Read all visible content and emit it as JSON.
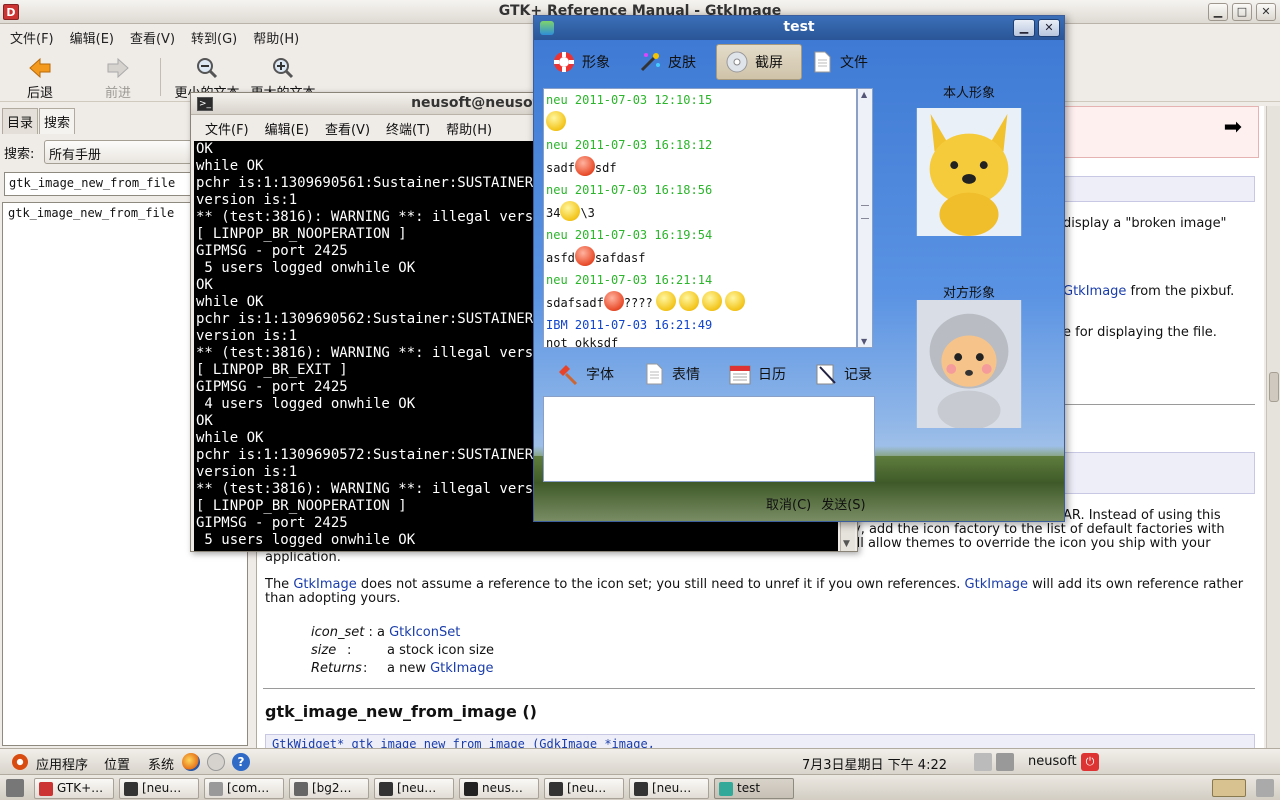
{
  "devhelp": {
    "title": "GTK+ Reference Manual - GtkImage",
    "menu": [
      "文件(F)",
      "编辑(E)",
      "查看(V)",
      "转到(G)",
      "帮助(H)"
    ],
    "toolbar": {
      "back": "后退",
      "forward": "前进",
      "smaller_text": "更小的文本",
      "larger_text": "更大的文本"
    },
    "tabs": [
      "目录",
      "搜索"
    ],
    "search_label": "搜索:",
    "search_scope": "所有手册",
    "search_query": "gtk_image_new_from_file",
    "results": [
      "gtk_image_new_from_file"
    ],
    "doc": {
      "line_broken": "display a \"broken image\"",
      "line_pixbuf_link": "GtkImage",
      "line_pixbuf": " from the pixbuf.",
      "line_display": "e for displaying the file.",
      "line_ar": "AR. Instead of using this",
      "line_factory": "y, add the icon factory to the list of default factories with",
      "line_themes": "ill allow themes to override the icon you ship with your",
      "line_application": "application.",
      "para_the": "The ",
      "para_link1": "GtkImage",
      "para_mid": " does not assume a reference to the icon set; you still need to unref it if you own references. ",
      "para_link2": "GtkImage",
      "para_end": " will add its own reference rather",
      "para_line2": "than adopting yours.",
      "params": [
        {
          "name": "icon_set",
          "sep": " : a ",
          "value": "GtkIconSet",
          "link": true
        },
        {
          "name": "size",
          "sep": " :",
          "value": "a stock icon size",
          "link": false
        },
        {
          "name": "Returns",
          "sep": " :",
          "value_prefix": "a new ",
          "value": "GtkImage",
          "link": true
        }
      ],
      "heading": "gtk_image_new_from_image ()",
      "code": "GtkWidget*          gtk_image_new_from_image            (GdkImage *image,"
    }
  },
  "terminal": {
    "title": "neusoft@neusoft-desktop: ~",
    "menu": [
      "文件(F)",
      "编辑(E)",
      "查看(V)",
      "终端(T)",
      "帮助(H)"
    ],
    "lines": [
      "OK",
      "while OK",
      "pchr is:1:1309690561:Sustainer:SUSTAINER-T",
      "version is:1",
      "** (test:3816): WARNING **: illegal versio",
      "[ LINPOP_BR_NOOPERATION ]",
      "GIPMSG - port 2425",
      " 5 users logged onwhile OK",
      "OK",
      "while OK",
      "pchr is:1:1309690562:Sustainer:SUSTAINER-T",
      "version is:1",
      "** (test:3816): WARNING **: illegal versio",
      "[ LINPOP_BR_EXIT ]",
      "GIPMSG - port 2425",
      " 4 users logged onwhile OK",
      "OK",
      "while OK",
      "pchr is:1:1309690572:Sustainer:SUSTAINER-T",
      "version is:1",
      "** (test:3816): WARNING **: illegal versio",
      "[ LINPOP_BR_NOOPERATION ]",
      "GIPMSG - port 2425",
      " 5 users logged onwhile OK"
    ]
  },
  "chat": {
    "title": "test",
    "tools_top": [
      "形象",
      "皮肤",
      "截屏",
      "文件"
    ],
    "tools_bottom": [
      "字体",
      "表情",
      "日历",
      "记录"
    ],
    "messages": [
      {
        "head": "neu  2011-07-03 12:10:15",
        "ibm": false,
        "body_pre": "",
        "emo": [
          "y"
        ],
        "body_post": ""
      },
      {
        "head": "neu  2011-07-03 16:18:12",
        "ibm": false,
        "body_pre": "sadf",
        "emo": [
          "r"
        ],
        "body_post": "sdf"
      },
      {
        "head": "neu  2011-07-03 16:18:56",
        "ibm": false,
        "body_pre": "34",
        "emo": [
          "y"
        ],
        "body_post": "\\3"
      },
      {
        "head": "neu  2011-07-03 16:19:54",
        "ibm": false,
        "body_pre": "asfd",
        "emo": [
          "r"
        ],
        "body_post": "safdasf"
      },
      {
        "head": "neu  2011-07-03 16:21:14",
        "ibm": false,
        "body_pre": "sdafsadf",
        "emo": [
          "r"
        ],
        "body_post": "????",
        "emo_after": [
          "y",
          "y",
          "y",
          "y"
        ]
      },
      {
        "head": "IBM  2011-07-03 16:21:49",
        "ibm": true,
        "body_pre": "not okksdf",
        "emo": [],
        "body_post": ""
      }
    ],
    "cancel": "取消(C)",
    "send": "发送(S)",
    "self_label": "本人形象",
    "peer_label": "对方形象"
  },
  "panel": {
    "applications": "应用程序",
    "places": "位置",
    "system": "系统",
    "datetime": "7月3日星期日 下午 4:22",
    "user": "neusoft"
  },
  "taskbar": [
    {
      "label": "GTK+…",
      "color": "#c33"
    },
    {
      "label": "[neu…",
      "color": "#333"
    },
    {
      "label": "[com…",
      "color": "#999"
    },
    {
      "label": "[bg2…",
      "color": "#666"
    },
    {
      "label": "[neu…",
      "color": "#333"
    },
    {
      "label": "neus…",
      "color": "#222"
    },
    {
      "label": "[neu…",
      "color": "#333"
    },
    {
      "label": "[neu…",
      "color": "#333"
    },
    {
      "label": "test",
      "color": "#3a9"
    }
  ]
}
